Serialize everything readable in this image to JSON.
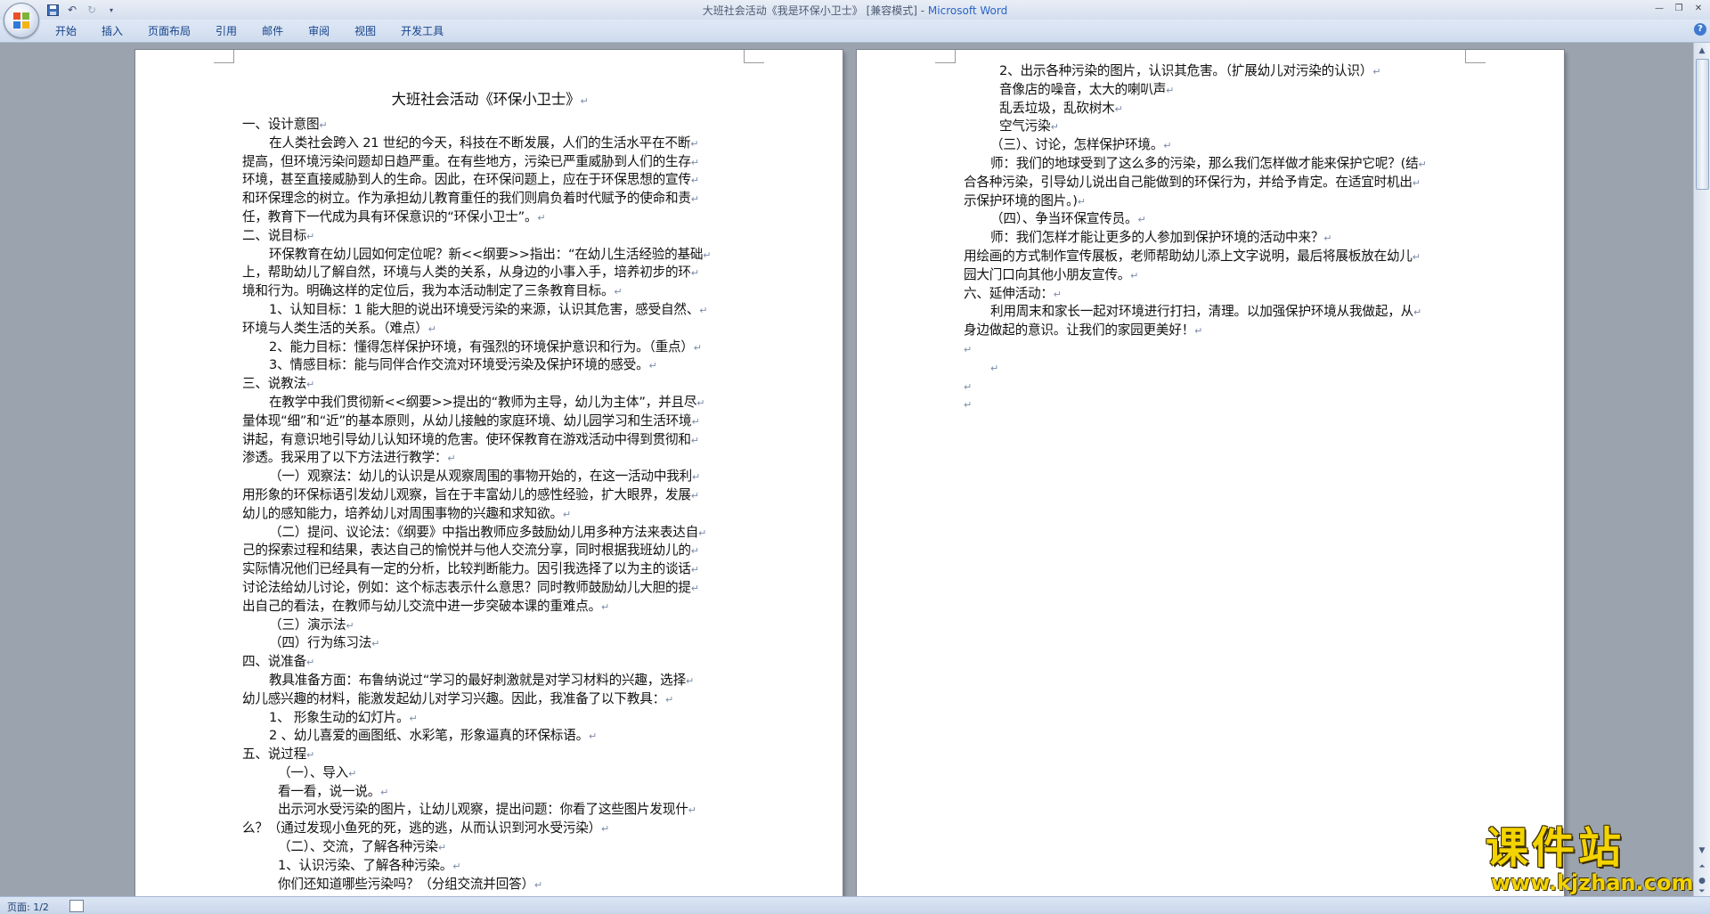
{
  "window": {
    "title_doc": "大班社会活动《我是环保小卫士》 [兼容模式] - ",
    "title_app": "Microsoft Word"
  },
  "ribbon": {
    "tabs": [
      "开始",
      "插入",
      "页面布局",
      "引用",
      "邮件",
      "审阅",
      "视图",
      "开发工具"
    ]
  },
  "status": {
    "page_count": "页面: 1/2"
  },
  "watermark": {
    "title": "课件站",
    "url": "www.kjzhan.com"
  },
  "page1": {
    "title": "大班社会活动《环保小卫士》",
    "lines": [
      {
        "t": "一、设计意图",
        "i": 0
      },
      {
        "t": "在人类社会跨入 21 世纪的今天，科技在不断发展，人们的生活水平在不断",
        "i": 1
      },
      {
        "t": "提高，但环境污染问题却日趋严重。在有些地方，污染已严重威胁到人们的生存",
        "i": 0
      },
      {
        "t": "环境，甚至直接威胁到人的生命。因此，在环保问题上，应在于环保思想的宣传",
        "i": 0
      },
      {
        "t": "和环保理念的树立。作为承担幼儿教育重任的我们则肩负着时代赋予的使命和责",
        "i": 0
      },
      {
        "t": "任，教育下一代成为具有环保意识的“环保小卫士”。",
        "i": 0
      },
      {
        "t": "二、说目标",
        "i": 0
      },
      {
        "t": "环保教育在幼儿园如何定位呢？新<<纲要>>指出：“在幼儿生活经验的基础",
        "i": 1
      },
      {
        "t": "上，帮助幼儿了解自然，环境与人类的关系，从身边的小事入手，培养初步的环",
        "i": 0
      },
      {
        "t": "境和行为。明确这样的定位后，我为本活动制定了三条教育目标。",
        "i": 0
      },
      {
        "t": "1、认知目标：1 能大胆的说出环境受污染的来源，认识其危害，感受自然、",
        "i": 1
      },
      {
        "t": "环境与人类生活的关系。（难点）",
        "i": 0
      },
      {
        "t": "2、能力目标：懂得怎样保护环境，有强烈的环境保护意识和行为。（重点）",
        "i": 1
      },
      {
        "t": "3、情感目标：能与同伴合作交流对环境受污染及保护环境的感受。",
        "i": 1
      },
      {
        "t": "三、说教法",
        "i": 0
      },
      {
        "t": "在教学中我们贯彻新<<纲要>>提出的“教师为主导，幼儿为主体”，并且尽",
        "i": 1
      },
      {
        "t": "量体现“细”和“近”的基本原则，从幼儿接触的家庭环境、幼儿园学习和生活环境",
        "i": 0
      },
      {
        "t": "讲起，有意识地引导幼儿认知环境的危害。使环保教育在游戏活动中得到贯彻和",
        "i": 0
      },
      {
        "t": "渗透。我采用了以下方法进行教学：",
        "i": 0
      },
      {
        "t": "（一）观察法：幼儿的认识是从观察周围的事物开始的，在这一活动中我利",
        "i": 1
      },
      {
        "t": "用形象的环保标语引发幼儿观察，旨在于丰富幼儿的感性经验，扩大眼界，发展",
        "i": 0
      },
      {
        "t": "幼儿的感知能力，培养幼儿对周围事物的兴趣和求知欲。",
        "i": 0
      },
      {
        "t": "（二）提问、议论法：《纲要》中指出教师应多鼓励幼儿用多种方法来表达自",
        "i": 1
      },
      {
        "t": "己的探索过程和结果，表达自己的愉悦并与他人交流分享，同时根据我班幼儿的",
        "i": 0
      },
      {
        "t": "实际情况他们已经具有一定的分析，比较判断能力。因引我选择了以为主的谈话",
        "i": 0
      },
      {
        "t": "讨论法给幼儿讨论，例如：这个标志表示什么意思？同时教师鼓励幼儿大胆的提",
        "i": 0
      },
      {
        "t": "出自己的看法，在教师与幼儿交流中进一步突破本课的重难点。",
        "i": 0
      },
      {
        "t": "（三）演示法",
        "i": 1
      },
      {
        "t": "（四）行为练习法",
        "i": 1
      },
      {
        "t": "四、说准备",
        "i": 0
      },
      {
        "t": "教具准备方面：布鲁纳说过“学习的最好刺激就是对学习材料的兴趣，选择",
        "i": 1
      },
      {
        "t": "幼儿感兴趣的材料，能激发起幼儿对学习兴趣。因此，我准备了以下教具：",
        "i": 0
      },
      {
        "t": "1、 形象生动的幻灯片。",
        "i": 1
      },
      {
        "t": "2 、幼儿喜爱的画图纸、水彩笔，形象逼真的环保标语。",
        "i": 1
      },
      {
        "t": "五、说过程",
        "i": 0
      },
      {
        "t": "（一）、导入",
        "i": 2
      },
      {
        "t": "看一看，说一说。",
        "i": 2
      },
      {
        "t": "出示河水受污染的图片，让幼儿观察，提出问题：你看了这些图片发现什",
        "i": 2
      },
      {
        "t": "么？（通过发现小鱼死的死，逃的逃，从而认识到河水受污染）",
        "i": 0
      },
      {
        "t": "（二）、交流，了解各种污染",
        "i": 2
      },
      {
        "t": "1、认识污染、了解各种污染。",
        "i": 2
      },
      {
        "t": "你们还知道哪些污染吗？（分组交流并回答）",
        "i": 2
      }
    ]
  },
  "page2": {
    "lines": [
      {
        "t": "2、出示各种污染的图片，认识其危害。（扩展幼儿对污染的认识）",
        "i": 2
      },
      {
        "t": "音像店的噪音，太大的喇叭声",
        "i": 2
      },
      {
        "t": "乱丢垃圾，乱砍树木",
        "i": 2
      },
      {
        "t": "空气污染",
        "i": 2
      },
      {
        "t": "（三）、讨论，怎样保护环境。",
        "i": 1
      },
      {
        "t": "师：我们的地球受到了这么多的污染，那么我们怎样做才能来保护它呢？(结",
        "i": 1
      },
      {
        "t": "合各种污染，引导幼儿说出自己能做到的环保行为，并给予肯定。在适宜时机出",
        "i": 0
      },
      {
        "t": "示保护环境的图片。)",
        "i": 0
      },
      {
        "t": "（四）、争当环保宣传员。",
        "i": 1
      },
      {
        "t": "师：我们怎样才能让更多的人参加到保护环境的活动中来？",
        "i": 1
      },
      {
        "t": "用绘画的方式制作宣传展板，老师帮助幼儿添上文字说明，最后将展板放在幼儿",
        "i": 0
      },
      {
        "t": "园大门口向其他小朋友宣传。",
        "i": 0
      },
      {
        "t": "六、延伸活动：",
        "i": 0
      },
      {
        "t": "利用周末和家长一起对环境进行打扫，清理。以加强保护环境从我做起，从",
        "i": 1
      },
      {
        "t": "身边做起的意识。让我们的家园更美好！",
        "i": 0
      },
      {
        "t": "",
        "i": 0
      },
      {
        "t": "",
        "i": 1
      },
      {
        "t": "",
        "i": 0
      },
      {
        "t": "",
        "i": 0
      }
    ]
  }
}
